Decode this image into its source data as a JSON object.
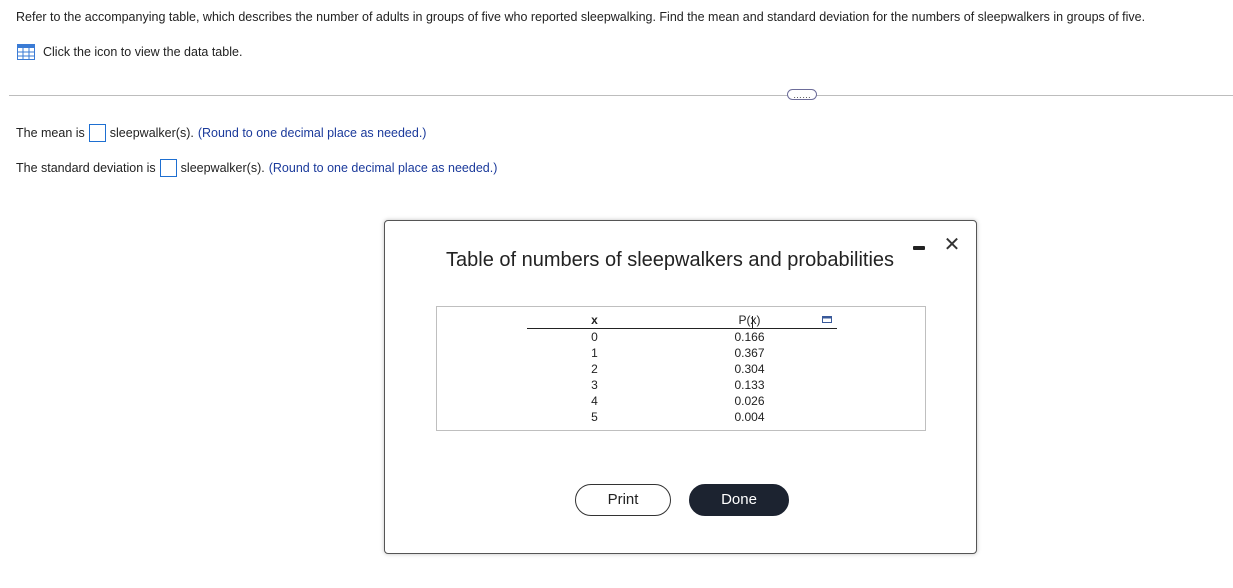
{
  "question": {
    "text": "Refer to the accompanying table, which describes the number of adults in groups of five who reported sleepwalking. Find the mean and standard deviation for the numbers of sleepwalkers in groups of five."
  },
  "data_link": {
    "text": "Click the icon to view the data table.",
    "icon": "table-grid-icon"
  },
  "more_button": {
    "label": "……"
  },
  "answers": {
    "mean": {
      "prefix": "The mean is",
      "suffix": "sleepwalker(s).",
      "note": "(Round to one decimal place as needed.)",
      "value": ""
    },
    "sd": {
      "prefix": "The standard deviation is",
      "suffix": "sleepwalker(s).",
      "note": "(Round to one decimal place as needed.)",
      "value": ""
    }
  },
  "modal": {
    "title": "Table of numbers of sleepwalkers and probabilities",
    "minimize_icon": "minimize-icon",
    "close_label": "✕",
    "table": {
      "headers": [
        "x",
        "P(x)"
      ],
      "rows": [
        [
          "0",
          "0.166"
        ],
        [
          "1",
          "0.367"
        ],
        [
          "2",
          "0.304"
        ],
        [
          "3",
          "0.133"
        ],
        [
          "4",
          "0.026"
        ],
        [
          "5",
          "0.004"
        ]
      ]
    },
    "print_label": "Print",
    "done_label": "Done"
  },
  "colors": {
    "input_border": "#1e6fd1",
    "note_text": "#1b3a9b",
    "done_bg": "#1c2330"
  }
}
